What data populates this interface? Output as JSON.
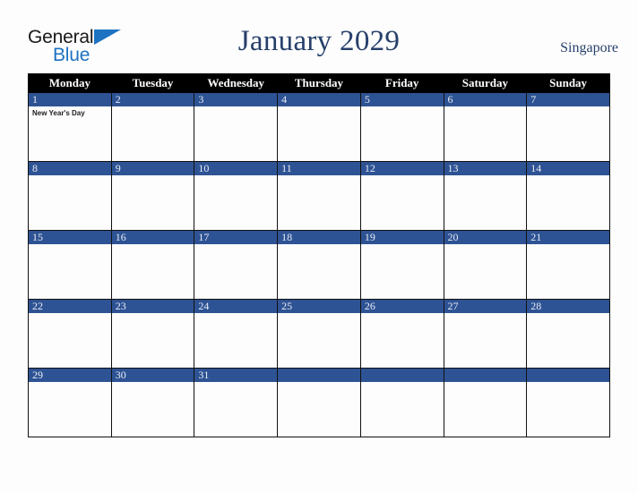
{
  "brand": {
    "name_part1": "General",
    "name_part2": "Blue",
    "triangle_icon": "triangle-icon"
  },
  "header": {
    "title": "January 2029",
    "country": "Singapore"
  },
  "colors": {
    "accent_blue": "#2E5394",
    "header_black": "#000000",
    "title_navy": "#27406B",
    "logo_blue": "#1D72C2",
    "cell_background": "#FDFDFD"
  },
  "calendar": {
    "weekday_headers": [
      "Monday",
      "Tuesday",
      "Wednesday",
      "Thursday",
      "Friday",
      "Saturday",
      "Sunday"
    ],
    "weeks": [
      [
        {
          "date": "1",
          "events": [
            "New Year's Day"
          ]
        },
        {
          "date": "2",
          "events": []
        },
        {
          "date": "3",
          "events": []
        },
        {
          "date": "4",
          "events": []
        },
        {
          "date": "5",
          "events": []
        },
        {
          "date": "6",
          "events": []
        },
        {
          "date": "7",
          "events": []
        }
      ],
      [
        {
          "date": "8",
          "events": []
        },
        {
          "date": "9",
          "events": []
        },
        {
          "date": "10",
          "events": []
        },
        {
          "date": "11",
          "events": []
        },
        {
          "date": "12",
          "events": []
        },
        {
          "date": "13",
          "events": []
        },
        {
          "date": "14",
          "events": []
        }
      ],
      [
        {
          "date": "15",
          "events": []
        },
        {
          "date": "16",
          "events": []
        },
        {
          "date": "17",
          "events": []
        },
        {
          "date": "18",
          "events": []
        },
        {
          "date": "19",
          "events": []
        },
        {
          "date": "20",
          "events": []
        },
        {
          "date": "21",
          "events": []
        }
      ],
      [
        {
          "date": "22",
          "events": []
        },
        {
          "date": "23",
          "events": []
        },
        {
          "date": "24",
          "events": []
        },
        {
          "date": "25",
          "events": []
        },
        {
          "date": "26",
          "events": []
        },
        {
          "date": "27",
          "events": []
        },
        {
          "date": "28",
          "events": []
        }
      ],
      [
        {
          "date": "29",
          "events": []
        },
        {
          "date": "30",
          "events": []
        },
        {
          "date": "31",
          "events": []
        },
        {
          "date": "",
          "events": []
        },
        {
          "date": "",
          "events": []
        },
        {
          "date": "",
          "events": []
        },
        {
          "date": "",
          "events": []
        }
      ]
    ]
  }
}
